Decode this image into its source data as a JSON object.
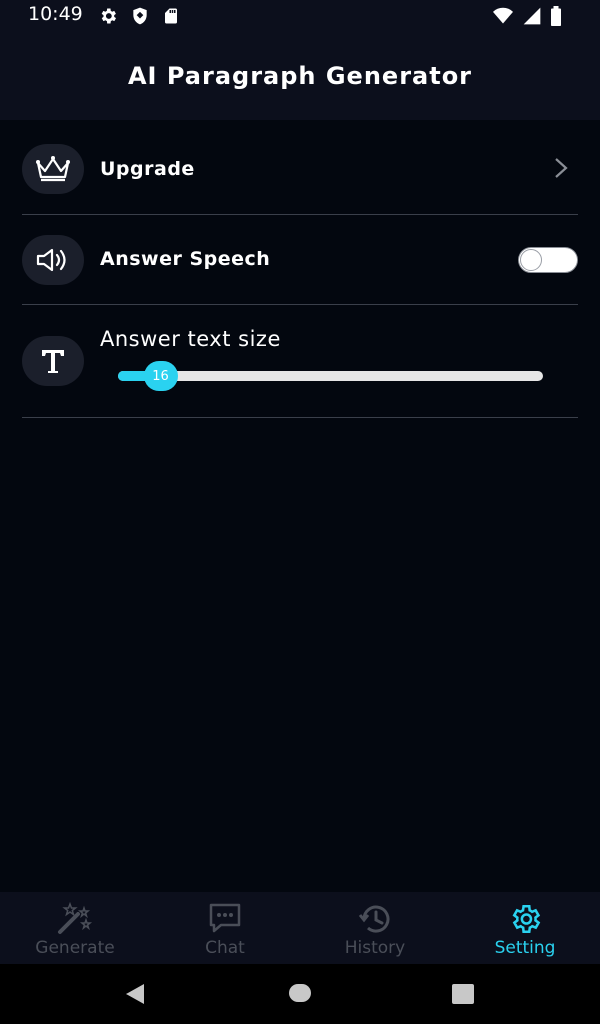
{
  "status_bar": {
    "time": "10:49",
    "left_icons": [
      "gear-icon",
      "shield-icon",
      "sd-card-icon"
    ],
    "right_icons": [
      "wifi-icon",
      "signal-icon",
      "battery-icon"
    ]
  },
  "header": {
    "title": "AI Paragraph Generator"
  },
  "settings": {
    "upgrade": {
      "label": "Upgrade",
      "icon": "crown-icon"
    },
    "answer_speech": {
      "label": "Answer Speech",
      "icon": "speaker-icon",
      "enabled": false
    },
    "answer_text_size": {
      "label": "Answer text size",
      "icon": "text-size-icon",
      "value": "16",
      "fraction": 0.1
    }
  },
  "bottom_nav": {
    "items": [
      {
        "label": "Generate",
        "icon": "magic-wand-icon",
        "active": false
      },
      {
        "label": "Chat",
        "icon": "chat-bubble-icon",
        "active": false
      },
      {
        "label": "History",
        "icon": "history-icon",
        "active": false
      },
      {
        "label": "Setting",
        "icon": "gear-icon",
        "active": true
      }
    ]
  },
  "colors": {
    "accent": "#2ad2f0",
    "background": "#03070f",
    "header_bg": "#0c0f1c",
    "inactive": "#4a4e58"
  }
}
